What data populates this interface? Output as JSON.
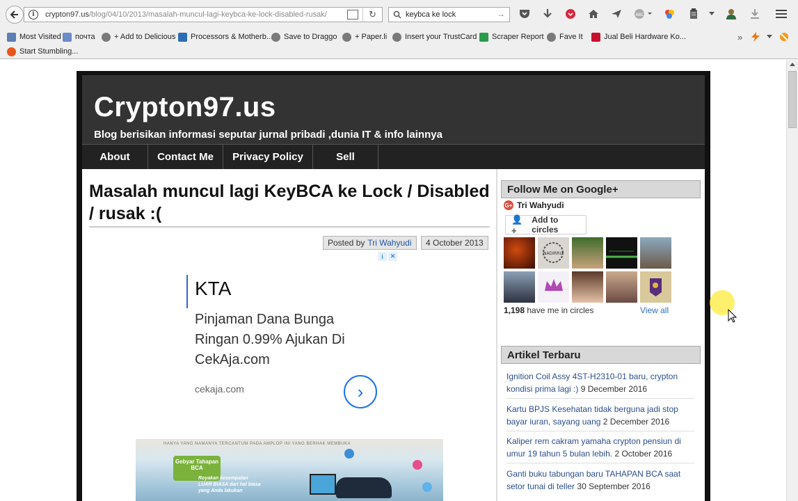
{
  "browser": {
    "url_host": "crypton97.us",
    "url_path": "/blog/04/10/2013/masalah-muncul-lagi-keybca-ke-lock-disabled-rusak/",
    "search_text": "keybca ke lock"
  },
  "bookmarks": [
    {
      "label": "Most Visited",
      "icon_color": "#5c7fb5"
    },
    {
      "label": "почта",
      "icon_color": "#6b8cc6"
    },
    {
      "label": "+ Add to Delicious",
      "icon_color": "#7a7a7a"
    },
    {
      "label": "Processors & Motherb...",
      "icon_color": "#2e6db4"
    },
    {
      "label": "Save to Draggo",
      "icon_color": "#7a7a7a"
    },
    {
      "label": "+ Paper.li",
      "icon_color": "#7a7a7a"
    },
    {
      "label": "Insert your TrustCard",
      "icon_color": "#7a7a7a"
    },
    {
      "label": "Scraper Report",
      "icon_color": "#2a9b4b"
    },
    {
      "label": "Fave It",
      "icon_color": "#7a7a7a"
    },
    {
      "label": "Jual Beli Hardware Ko...",
      "icon_color": "#c8102e"
    },
    {
      "label": "Start Stumbling...",
      "icon_color": "#e8541b"
    }
  ],
  "blog": {
    "title": "Crypton97.us",
    "description": "Blog berisikan informasi seputar jurnal pribadi ,dunia IT & info lainnya",
    "nav": [
      "About",
      "Contact Me",
      "Privacy Policy",
      "Sell"
    ]
  },
  "post": {
    "title": "Masalah muncul lagi KeyBCA ke Lock / Disabled / rusak :(",
    "posted_by_label": "Posted by",
    "author": "Tri Wahyudi",
    "date": "4 October 2013"
  },
  "ad": {
    "headline": "KTA",
    "body": "Pinjaman Dana Bunga Ringan 0.99% Ajukan Di CekAja.com",
    "domain": "cekaja.com"
  },
  "post_image": {
    "strip_text": "HANYA YANG NAMANYA TERCANTUM PADA AMPLOP INI YANG BERHAK MEMBUKA",
    "badge": "Gebyar Tahapan BCA",
    "promo": "Royakan kesempatan LUAR BIASA dari hal biasa yang Anda lakukan"
  },
  "sidebar": {
    "google_plus": {
      "heading": "Follow Me on Google+",
      "profile_name": "Tri Wahyudi",
      "add_button": "Add to circles",
      "circle_count": "1,198",
      "circle_text": "have me in circles",
      "view_all": "View all"
    },
    "recent": {
      "heading": "Artikel Terbaru",
      "items": [
        {
          "title": "Ignition Coil Assy 4ST-H2310-01 baru, crypton kondisi prima lagi :)",
          "date": "9 December 2016"
        },
        {
          "title": "Kartu BPJS Kesehatan tidak berguna jadi stop bayar iuran, sayang uang",
          "date": "2 December 2016"
        },
        {
          "title": "Kaliper rem cakram yamaha crypton pensiun di umur 19 tahun 5 bulan lebih.",
          "date": "2 October 2016"
        },
        {
          "title": "Ganti buku tabungan baru TAHAPAN BCA saat setor tunai di teller",
          "date": "30 September 2016"
        }
      ]
    }
  }
}
